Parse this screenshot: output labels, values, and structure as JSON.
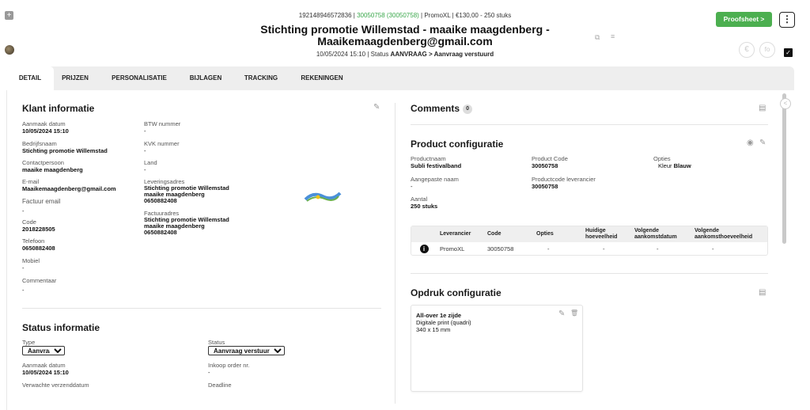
{
  "header": {
    "line1_prefix": "192148946572836",
    "line1_sep1": " | ",
    "line1_code": "30050758 (30050758)",
    "line1_sep2": " | ",
    "line1_supplier": "PromoXL",
    "line1_sep3": " | ",
    "line1_price": "€130,00 - 250 stuks",
    "title_line1": "Stichting promotie Willemstad - maaike maagdenberg -",
    "title_line2": "Maaikemaagdenberg@gmail.com",
    "date": "10/05/2024 15:10",
    "status_prefix": " | Status ",
    "status_value": "AANVRAAG > Aanvraag verstuurd",
    "proofsheet_label": "Proofsheet  >",
    "menu_glyph": "⋮"
  },
  "icons": {
    "plus": "+",
    "copy": "⧉",
    "list": "≡",
    "euro": "€",
    "fo": "fo",
    "check": "✓",
    "edit": "✎",
    "eye": "◉",
    "trash": "🗑",
    "doc": "▤",
    "collapse": "<",
    "info": "i"
  },
  "tabs": [
    {
      "label": "DETAIL"
    },
    {
      "label": "PRIJZEN"
    },
    {
      "label": "PERSONALISATIE"
    },
    {
      "label": "BIJLAGEN"
    },
    {
      "label": "TRACKING"
    },
    {
      "label": "REKENINGEN"
    }
  ],
  "klant": {
    "title": "Klant informatie",
    "left": [
      {
        "label": "Aanmaak datum",
        "value": "10/05/2024 15:10"
      },
      {
        "label": "Bedrijfsnaam",
        "value": "Stichting promotie Willemstad"
      },
      {
        "label": "Contactpersoon",
        "value": "maaike maagdenberg"
      },
      {
        "label": "E-mail",
        "value": "Maaikemaagdenberg@gmail.com"
      },
      {
        "label": "Factuur email",
        "value": "-"
      },
      {
        "label": "Code",
        "value": "2018228505"
      },
      {
        "label": "Telefoon",
        "value": "0650882408"
      },
      {
        "label": "Mobiel",
        "value": "-"
      },
      {
        "label": "Commentaar",
        "value": "-"
      }
    ],
    "right": {
      "btw_label": "BTW nummer",
      "btw_value": "-",
      "kvk_label": "KVK nummer",
      "kvk_value": "-",
      "land_label": "Land",
      "land_value": "-",
      "lever_label": "Leveringsadres",
      "lever_line1": "Stichting promotie Willemstad",
      "lever_line2": "maaike maagdenberg",
      "lever_line3": "0650882408",
      "fact_label": "Factuuradres",
      "fact_line1": "Stichting promotie Willemstad",
      "fact_line2": "maaike maagdenberg",
      "fact_line3": "0650882408"
    }
  },
  "status": {
    "title": "Status informatie",
    "type_label": "Type",
    "type_value": "Aanvraag",
    "status_label": "Status",
    "status_value": "Aanvraag verstuurd",
    "aanmaak_label": "Aanmaak datum",
    "aanmaak_value": "10/05/2024 15:10",
    "inkoop_label": "Inkoop order nr.",
    "inkoop_value": "-",
    "verzend_label": "Verwachte verzenddatum",
    "deadline_label": "Deadline"
  },
  "comments": {
    "title": "Comments",
    "count": "0"
  },
  "product": {
    "title": "Product configuratie",
    "naam_label": "Productnaam",
    "naam_value": "Subli festivalband",
    "code_label": "Product Code",
    "code_value": "30050758",
    "opties_label": "Opties",
    "opties_key": "Kleur",
    "opties_value": "Blauw",
    "aangepast_label": "Aangepaste naam",
    "aangepast_value": "-",
    "levcode_label": "Productcode leverancier",
    "levcode_value": "30050758",
    "aantal_label": "Aantal",
    "aantal_value": "250 stuks",
    "table_headers": [
      "Leverancier",
      "Code",
      "Opties",
      "Huidige hoeveelheid",
      "Volgende aankomstdatum",
      "Volgende aankomsthoeveelheid"
    ],
    "table_rows": [
      [
        "PromoXL",
        "30050758",
        "-",
        "-",
        "-",
        "-"
      ]
    ]
  },
  "opdruk": {
    "title": "Opdruk configuratie",
    "card_title": "All-over 1e zijde",
    "card_line1": "Digitale print (quadri)",
    "card_line2": "340 x 15 mm"
  },
  "colors": {
    "accent_green": "#4caf50",
    "link_green": "#3aa84b"
  }
}
